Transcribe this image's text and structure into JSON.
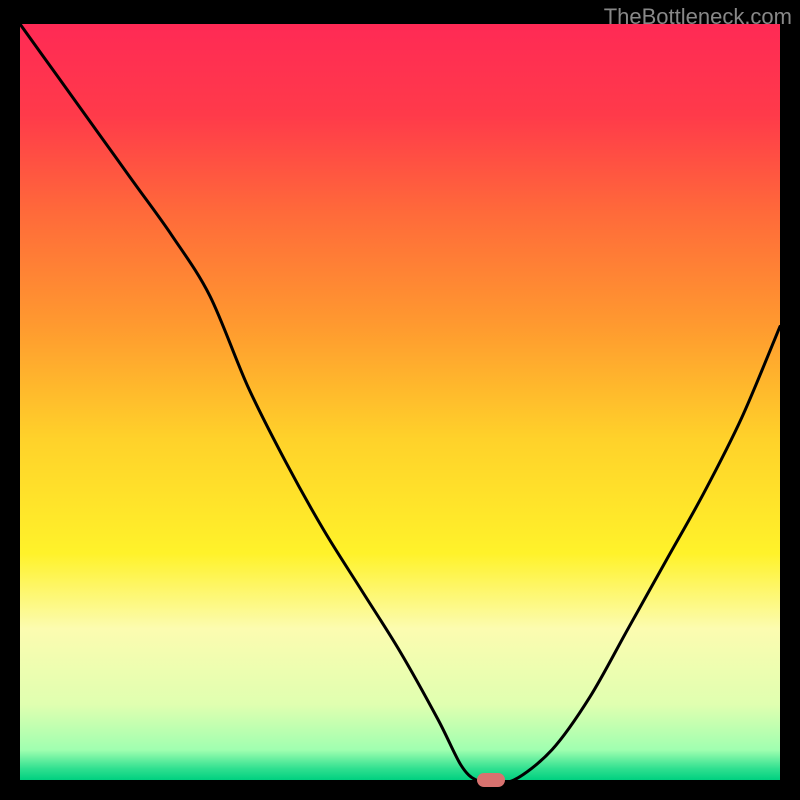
{
  "watermark": "TheBottleneck.com",
  "chart_data": {
    "type": "line",
    "title": "",
    "xlabel": "",
    "ylabel": "",
    "xlim": [
      0,
      100
    ],
    "ylim": [
      0,
      100
    ],
    "background": {
      "type": "vertical-gradient",
      "stops": [
        {
          "offset": 0.0,
          "color": "#ff2a55"
        },
        {
          "offset": 0.12,
          "color": "#ff3a4a"
        },
        {
          "offset": 0.25,
          "color": "#ff6a3a"
        },
        {
          "offset": 0.4,
          "color": "#ff9a2f"
        },
        {
          "offset": 0.55,
          "color": "#ffd22a"
        },
        {
          "offset": 0.7,
          "color": "#fff22a"
        },
        {
          "offset": 0.8,
          "color": "#fcfcb0"
        },
        {
          "offset": 0.9,
          "color": "#e0ffb0"
        },
        {
          "offset": 0.96,
          "color": "#a0ffb0"
        },
        {
          "offset": 0.985,
          "color": "#30e090"
        },
        {
          "offset": 1.0,
          "color": "#00d080"
        }
      ]
    },
    "series": [
      {
        "name": "curve",
        "color": "#000000",
        "x": [
          0,
          5,
          10,
          15,
          20,
          25,
          30,
          35,
          40,
          45,
          50,
          55,
          58,
          60,
          62,
          65,
          70,
          75,
          80,
          85,
          90,
          95,
          100
        ],
        "y": [
          100,
          93,
          86,
          79,
          72,
          64,
          52,
          42,
          33,
          25,
          17,
          8,
          2,
          0,
          0,
          0,
          4,
          11,
          20,
          29,
          38,
          48,
          60
        ]
      }
    ],
    "marker": {
      "x": 62,
      "y": 0,
      "color": "#d8726f",
      "shape": "pill"
    }
  }
}
